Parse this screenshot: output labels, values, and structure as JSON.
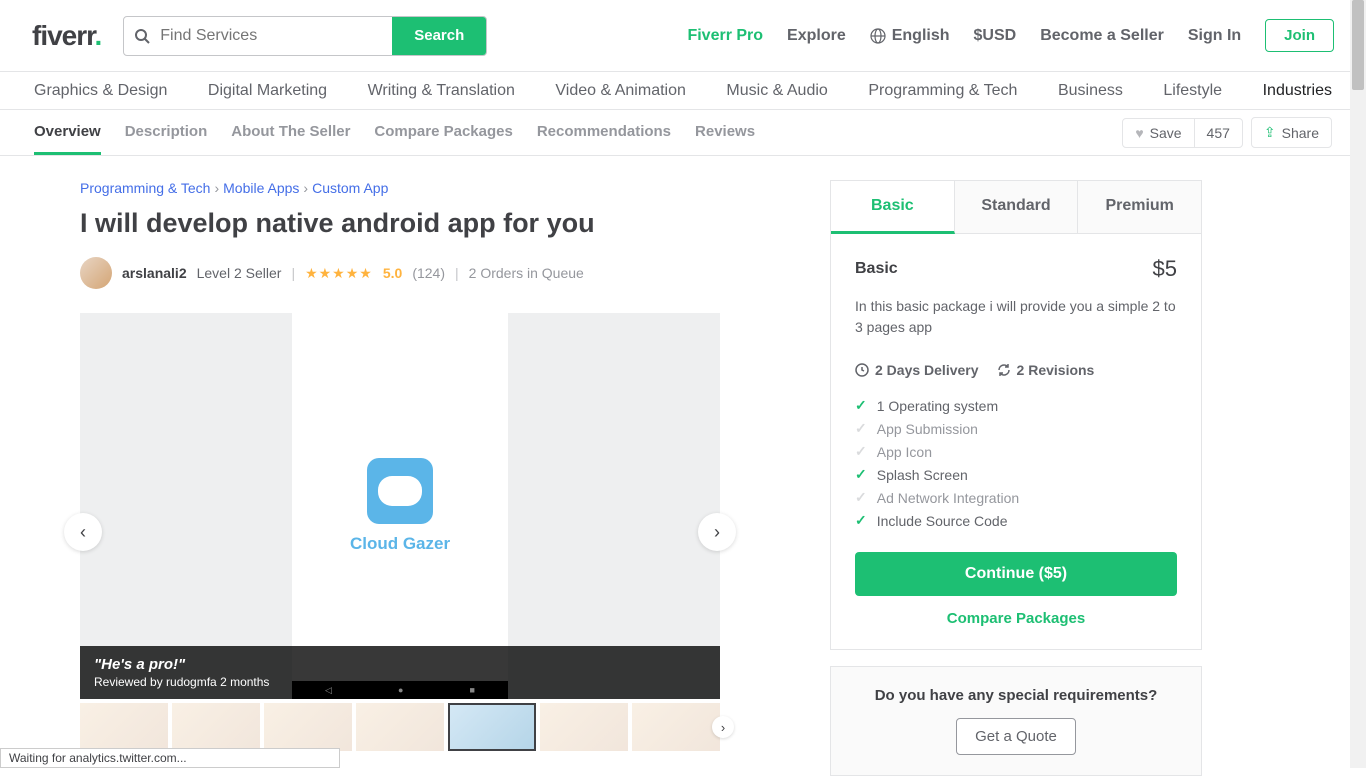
{
  "header": {
    "logo_main": "fiverr",
    "logo_dot": ".",
    "search_placeholder": "Find Services",
    "search_button": "Search",
    "pro": "Fiverr Pro",
    "explore": "Explore",
    "language": "English",
    "currency": "$USD",
    "become_seller": "Become a Seller",
    "sign_in": "Sign In",
    "join": "Join"
  },
  "categories": {
    "items": [
      "Graphics & Design",
      "Digital Marketing",
      "Writing & Translation",
      "Video & Animation",
      "Music & Audio",
      "Programming & Tech",
      "Business",
      "Lifestyle"
    ],
    "industries": "Industries"
  },
  "subnav": {
    "tabs": [
      "Overview",
      "Description",
      "About The Seller",
      "Compare Packages",
      "Recommendations",
      "Reviews"
    ],
    "save_label": "Save",
    "save_count": "457",
    "share_label": "Share"
  },
  "breadcrumb": {
    "items": [
      "Programming & Tech",
      "Mobile Apps",
      "Custom App"
    ]
  },
  "gig": {
    "title": "I will develop native android app for you",
    "seller": "arslanali2",
    "level": "Level 2 Seller",
    "rating": "5.0",
    "reviews": "(124)",
    "queue": "2 Orders in Queue",
    "app_name": "Cloud Gazer",
    "overlay_quote": "\"He's a pro!\"",
    "overlay_by": "Reviewed by rudogmfa 2 months"
  },
  "package": {
    "tabs": [
      "Basic",
      "Standard",
      "Premium"
    ],
    "name": "Basic",
    "price": "$5",
    "description": "In this basic package i will provide you a simple 2 to 3 pages app",
    "delivery": "2 Days Delivery",
    "revisions": "2 Revisions",
    "features": [
      {
        "label": "1 Operating system",
        "on": true
      },
      {
        "label": "App Submission",
        "on": false
      },
      {
        "label": "App Icon",
        "on": false
      },
      {
        "label": "Splash Screen",
        "on": true
      },
      {
        "label": "Ad Network Integration",
        "on": false
      },
      {
        "label": "Include Source Code",
        "on": true
      }
    ],
    "continue": "Continue ($5)",
    "compare": "Compare Packages"
  },
  "quote": {
    "question": "Do you have any special requirements?",
    "button": "Get a Quote"
  },
  "status": "Waiting for analytics.twitter.com..."
}
